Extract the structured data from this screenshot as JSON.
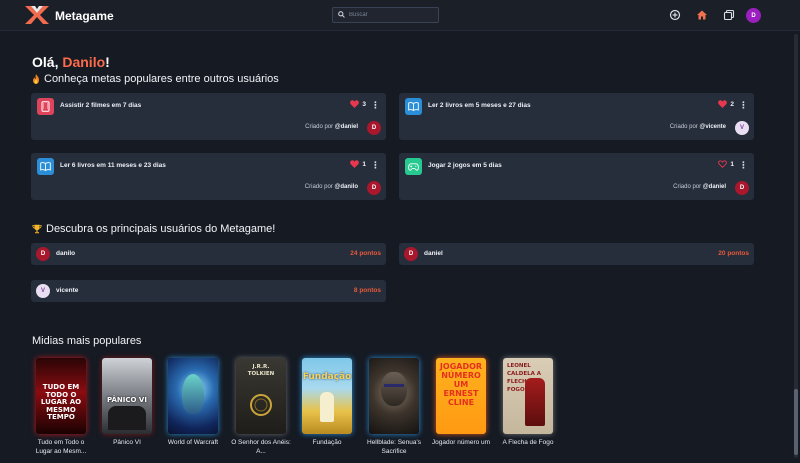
{
  "app": {
    "brand": "Metagame"
  },
  "search": {
    "placeholder": "Buscar"
  },
  "user": {
    "initial": "D"
  },
  "greeting": {
    "prefix": "Olá, ",
    "name": "Danilo",
    "suffix": "!"
  },
  "popular_goals": {
    "title": "Conheça metas populares entre outros usuários",
    "created_by_label": "Criado por",
    "items": [
      {
        "title": "Assistir 2 filmes em 7 dias",
        "likes": "3",
        "liked": true,
        "creator": "@daniel",
        "avatar": "D",
        "icon": "film-icon",
        "icon_color": "#e0445c",
        "avatar_color": "#a8172c"
      },
      {
        "title": "Ler 2 livros em 5 meses e 27 dias",
        "likes": "2",
        "liked": true,
        "creator": "@vicente",
        "avatar": "V",
        "icon": "book-icon",
        "icon_color": "#2a8fd8",
        "avatar_color": "#eadff2"
      },
      {
        "title": "Ler 6 livros em 11 meses e 23 dias",
        "likes": "1",
        "liked": true,
        "creator": "@danilo",
        "avatar": "D",
        "icon": "book-icon",
        "icon_color": "#2a8fd8",
        "avatar_color": "#a8172c"
      },
      {
        "title": "Jogar 2 jogos em 5 dias",
        "likes": "1",
        "liked": false,
        "creator": "@daniel",
        "avatar": "D",
        "icon": "gamepad-icon",
        "icon_color": "#26c98f",
        "avatar_color": "#a8172c"
      }
    ]
  },
  "top_users": {
    "title": "Descubra os principais usuários do Metagame!",
    "items": [
      {
        "name": "danilo",
        "points": "24 pontos",
        "avatar": "D",
        "avatar_color": "#a8172c"
      },
      {
        "name": "daniel",
        "points": "20 pontos",
        "avatar": "D",
        "avatar_color": "#a8172c"
      },
      {
        "name": "vicente",
        "points": "8 pontos",
        "avatar": "V",
        "avatar_color": "#eadff2"
      }
    ]
  },
  "media": {
    "title": "Midias mais populares",
    "items": [
      {
        "caption": "Tudo em Todo o Lugar ao Mesm...",
        "poster_text": "TUDO EM TODO O LUGAR AO MESMO TEMPO"
      },
      {
        "caption": "Pânico VI",
        "poster_text": "PÂNICO VI"
      },
      {
        "caption": "World of Warcraft",
        "poster_text": ""
      },
      {
        "caption": "O Senhor dos Anéis: A...",
        "poster_text": "J.R.R. TOLKIEN"
      },
      {
        "caption": "Fundação",
        "poster_text": "Fundação"
      },
      {
        "caption": "Hellblade: Senua's Sacrifice",
        "poster_text": ""
      },
      {
        "caption": "Jogador número um",
        "poster_text": "JOGADOR NÚMERO UM ERNEST CLINE"
      },
      {
        "caption": "A Flecha de Fogo",
        "poster_text": "LEONEL CALDELA A FLECHA DE FOGO"
      }
    ]
  }
}
